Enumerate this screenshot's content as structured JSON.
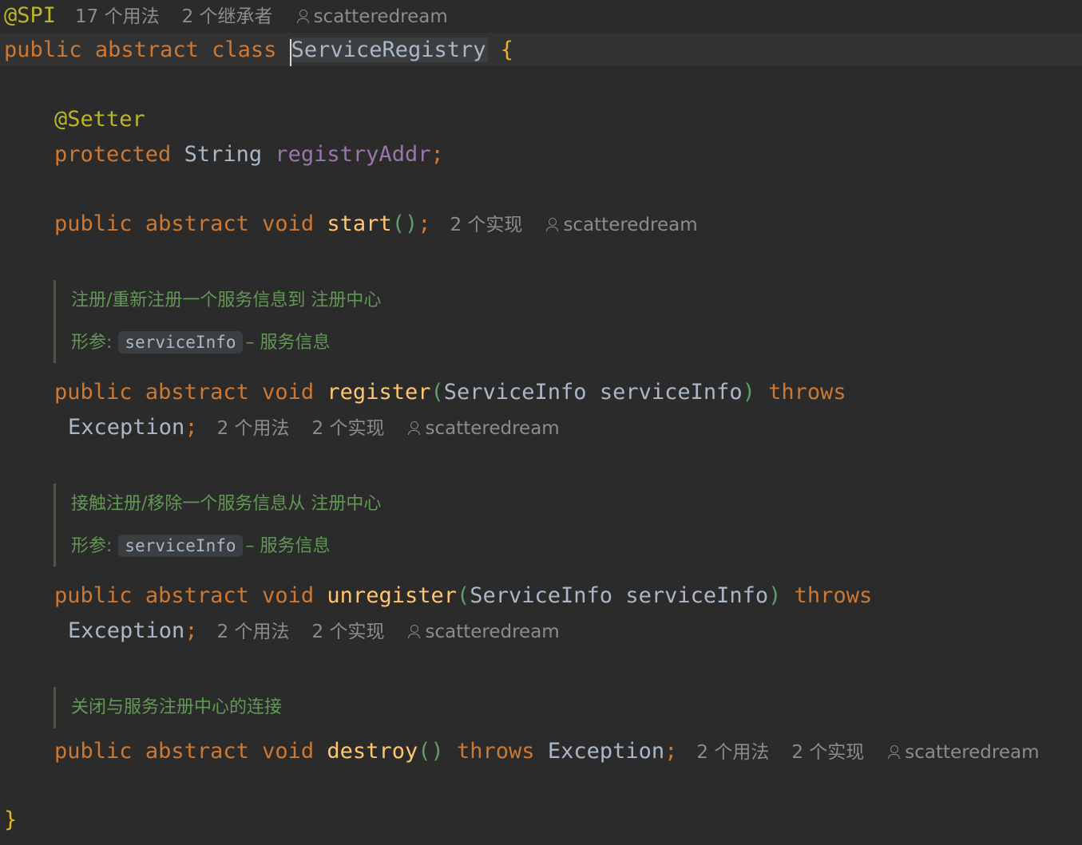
{
  "top_hint": {
    "annotation": "@SPI",
    "usages": "17 个用法",
    "inheritors": "2 个继承者",
    "author": "scatteredream"
  },
  "class_decl": {
    "kw1": "public",
    "kw2": "abstract",
    "kw3": "class",
    "name": "ServiceRegistry",
    "brace": "{"
  },
  "field": {
    "annotation": "@Setter",
    "modifier": "protected",
    "type": "String",
    "name": "registryAddr",
    "semi": ";"
  },
  "start": {
    "kw1": "public",
    "kw2": "abstract",
    "kw3": "void",
    "name": "start",
    "parens": "()",
    "semi": ";",
    "impls": "2 个实现",
    "author": "scatteredream"
  },
  "register_doc": {
    "summary": "注册/重新注册一个服务信息到 注册中心",
    "param_label": "形参:",
    "param_name": "serviceInfo",
    "param_desc": "– 服务信息"
  },
  "register": {
    "kw1": "public",
    "kw2": "abstract",
    "kw3": "void",
    "name": "register",
    "open": "(",
    "ptype": "ServiceInfo",
    "pname": "serviceInfo",
    "close": ")",
    "throws": "throws",
    "exc": "Exception",
    "semi": ";",
    "usages": "2 个用法",
    "impls": "2 个实现",
    "author": "scatteredream"
  },
  "unregister_doc": {
    "summary": "接触注册/移除一个服务信息从 注册中心",
    "param_label": "形参:",
    "param_name": "serviceInfo",
    "param_desc": "– 服务信息"
  },
  "unregister": {
    "kw1": "public",
    "kw2": "abstract",
    "kw3": "void",
    "name": "unregister",
    "open": "(",
    "ptype": "ServiceInfo",
    "pname": "serviceInfo",
    "close": ")",
    "throws": "throws",
    "exc": "Exception",
    "semi": ";",
    "usages": "2 个用法",
    "impls": "2 个实现",
    "author": "scatteredream"
  },
  "destroy_doc": {
    "summary": "关闭与服务注册中心的连接"
  },
  "destroy": {
    "kw1": "public",
    "kw2": "abstract",
    "kw3": "void",
    "name": "destroy",
    "parens": "()",
    "throws": "throws",
    "exc": "Exception",
    "semi": ";",
    "usages": "2 个用法",
    "impls": "2 个实现",
    "author": "scatteredream"
  },
  "closing_brace": "}",
  "colors": {
    "background": "#2b2b2b",
    "keyword": "#cc7832",
    "annotation": "#bbb529",
    "field": "#9876aa",
    "method": "#ffc66d",
    "doc": "#629755",
    "hint": "#8c8c8c"
  }
}
